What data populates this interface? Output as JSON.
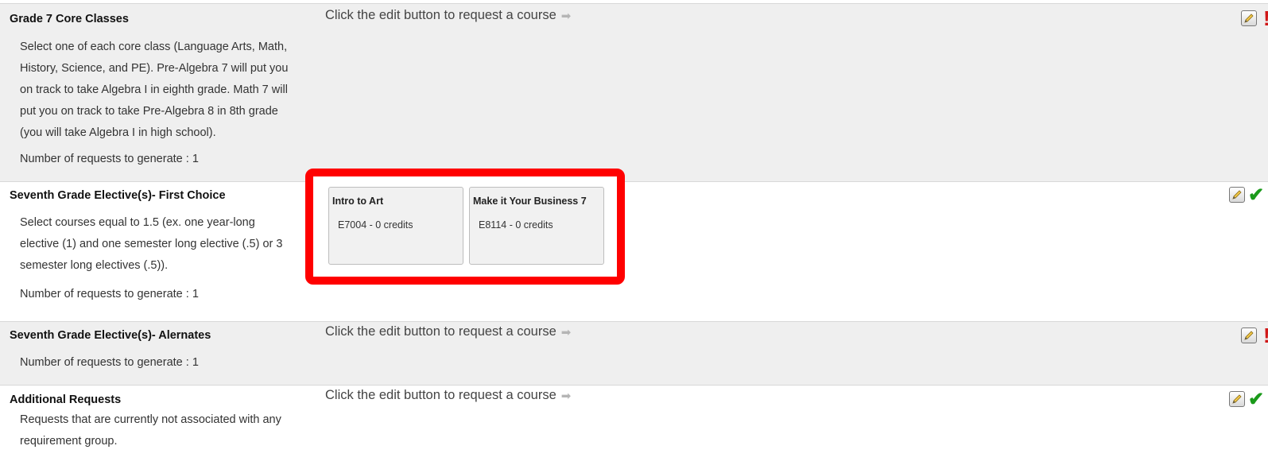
{
  "groups": [
    {
      "title": "Grade 7 Core Classes",
      "description_lines": [
        "Select one of each core class (Language Arts, Math,",
        "History, Science, and PE). Pre-Algebra 7 will put you",
        "on track to take Algebra I in eighth grade. Math 7 will",
        "put you on track to take Pre-Algebra 8 in 8th grade",
        "(you will take Algebra I in high school)."
      ],
      "num_requests": "Number of requests to generate : 1",
      "hint": "Click the edit button to request a course",
      "status": "incomplete",
      "status_icon": "exclamation-icon"
    },
    {
      "title": "Seventh Grade Elective(s)- First Choice",
      "description_lines": [
        "Select courses equal to 1.5 (ex. one year-long",
        "elective (1) and one semester long elective (.5) or 3",
        "semester long electives (.5))."
      ],
      "num_requests": "Number of requests to generate : 1",
      "courses": [
        {
          "name": "Intro to Art",
          "code": "E7004 - 0 credits"
        },
        {
          "name": "Make it Your Business 7",
          "code": "E8114 - 0 credits"
        }
      ],
      "status": "complete",
      "status_icon": "checkmark-icon"
    },
    {
      "title": "Seventh Grade Elective(s)- Alernates",
      "num_requests": "Number of requests to generate : 1",
      "hint": "Click the edit button to request a course",
      "status": "incomplete",
      "status_icon": "exclamation-icon"
    },
    {
      "title": "Additional Requests",
      "description_lines": [
        "Requests that are currently not associated with any",
        "requirement group."
      ],
      "hint": "Click the edit button to request a course",
      "status": "complete",
      "status_icon": "checkmark-icon"
    }
  ],
  "icons": {
    "edit": "pencil-edit-icon",
    "arrow": "arrow-right-icon"
  },
  "colors": {
    "incomplete": "#d01818",
    "complete": "#1a9a1a",
    "highlight": "#ff0000",
    "shaded_row": "#efefef"
  }
}
